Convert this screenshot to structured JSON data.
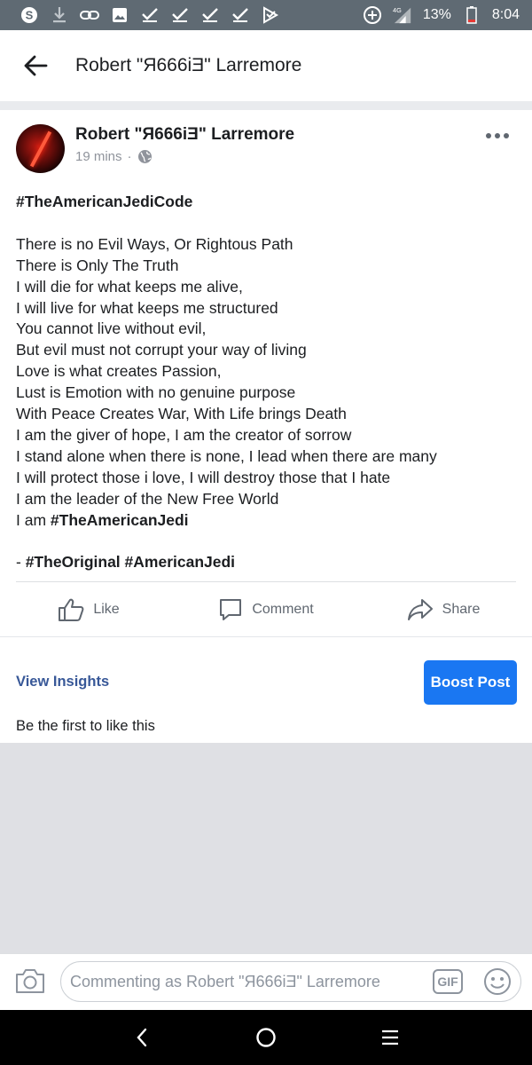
{
  "status_bar": {
    "icons_left": [
      "skype-icon",
      "download-icon",
      "link-icon",
      "image-icon",
      "check-icon",
      "check-icon",
      "check-icon",
      "check-icon",
      "play-store-icon"
    ],
    "icons_right": [
      "data-saver-icon",
      "signal-4g-icon"
    ],
    "battery": "13%",
    "battery_color": "#e53935",
    "time": "8:04",
    "bg_color": "#5f6a73"
  },
  "header": {
    "title": "Robert \"Я666iƎ\" Larremore"
  },
  "post": {
    "author": "Robert \"Я666iƎ\" Larremore",
    "time": "19 mins",
    "separator": "·",
    "privacy": "globe-icon",
    "lines": [
      {
        "text": "#TheAmericanJediCode",
        "bold": true
      },
      {
        "text": ""
      },
      {
        "text": "There is no Evil Ways, Or Rightous Path"
      },
      {
        "text": "There is Only The Truth"
      },
      {
        "text": "I will die for what keeps me alive,"
      },
      {
        "text": "I will live for what keeps me structured"
      },
      {
        "text": "You cannot live without evil,"
      },
      {
        "text": "But evil must not corrupt your way of living"
      },
      {
        "text": "Love is what creates Passion,"
      },
      {
        "text": "Lust is Emotion with no genuine purpose"
      },
      {
        "text": "With Peace Creates War, With Life brings Death"
      },
      {
        "text": "I am the giver of hope, I am the creator of sorrow"
      },
      {
        "text": "I stand alone when there is none, I lead when there are many"
      },
      {
        "text": "I will protect those i love, I will destroy those that I hate"
      },
      {
        "text": "I am the leader of the New Free World"
      },
      {
        "text": "I am ",
        "tag": "#TheAmericanJedi"
      },
      {
        "text": ""
      },
      {
        "text": "- ",
        "tag": "#TheOriginal #AmericanJedi"
      }
    ]
  },
  "actions": {
    "like": "Like",
    "comment": "Comment",
    "share": "Share"
  },
  "insights": {
    "view_insights": "View Insights",
    "boost_post": "Boost Post",
    "likes_text": "Be the first to like this",
    "accent": "#385898",
    "button_color": "#1a77f2"
  },
  "comment_bar": {
    "placeholder": "Commenting as Robert \"Я666iƎ\" Larremore",
    "gif": "GIF"
  },
  "nav": {
    "icons": [
      "back-icon",
      "home-icon",
      "menu-icon"
    ]
  }
}
